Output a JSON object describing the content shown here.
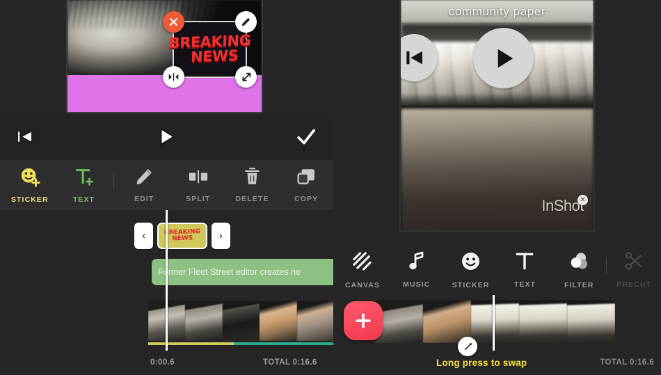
{
  "app": {
    "watermark": "InShot"
  },
  "left_screen": {
    "preview": {
      "sticker": {
        "line1": "BREAKING",
        "line2": "NEWS"
      },
      "handles": {
        "delete": "close-icon",
        "edit": "pencil-icon",
        "flip": "flip-horizontal-icon",
        "resize": "resize-icon"
      }
    },
    "playback": {
      "rewind_label": "rewind-to-start",
      "play_label": "play",
      "confirm_label": "confirm"
    },
    "toolbar": [
      {
        "label": "STICKER",
        "icon": "smiley-plus-icon",
        "state": "active-yellow"
      },
      {
        "label": "TEXT",
        "icon": "text-plus-icon",
        "state": "active-green"
      },
      {
        "label": "EDIT",
        "icon": "pencil-icon",
        "state": "normal"
      },
      {
        "label": "SPLIT",
        "icon": "split-icon",
        "state": "normal"
      },
      {
        "label": "DELETE",
        "icon": "trash-icon",
        "state": "normal"
      },
      {
        "label": "COPY",
        "icon": "copy-icon",
        "state": "normal"
      }
    ],
    "timeline": {
      "prev_label": "‹",
      "next_label": "›",
      "sticker_thumb": {
        "line1": "BREAKING",
        "line2": "NEWS"
      },
      "text_clip": "Former Fleet Street editor creates ne",
      "current_time": "0:00.6",
      "total_time": "TOTAL 0:16.6"
    }
  },
  "right_screen": {
    "preview": {
      "caption": "community paper",
      "rewind_label": "rewind-to-start",
      "play_label": "play",
      "watermark": "InShot",
      "watermark_close": "✕"
    },
    "toolbar": [
      {
        "label": "CANVAS",
        "icon": "canvas-icon",
        "state": "normal"
      },
      {
        "label": "MUSIC",
        "icon": "music-note-icon",
        "state": "normal"
      },
      {
        "label": "STICKER",
        "icon": "smiley-icon",
        "state": "normal"
      },
      {
        "label": "TEXT",
        "icon": "text-icon",
        "state": "normal"
      },
      {
        "label": "FILTER",
        "icon": "filter-circles-icon",
        "state": "normal"
      },
      {
        "label": "PRECUT",
        "icon": "scissors-icon",
        "state": "dim"
      }
    ],
    "timeline": {
      "add_label": "+",
      "transition_label": "transition",
      "hint": "Long press to swap",
      "total_time": "TOTAL 0:16.6"
    }
  },
  "colors": {
    "accent_red": "#f2394f",
    "sticker_delete": "#f15a36",
    "text_clip_green": "#8cc183",
    "track_teal": "#2fae8e",
    "track_yellow": "#d2cb5a",
    "hint_yellow": "#f5e03c",
    "banner_purple": "#df73e8"
  }
}
